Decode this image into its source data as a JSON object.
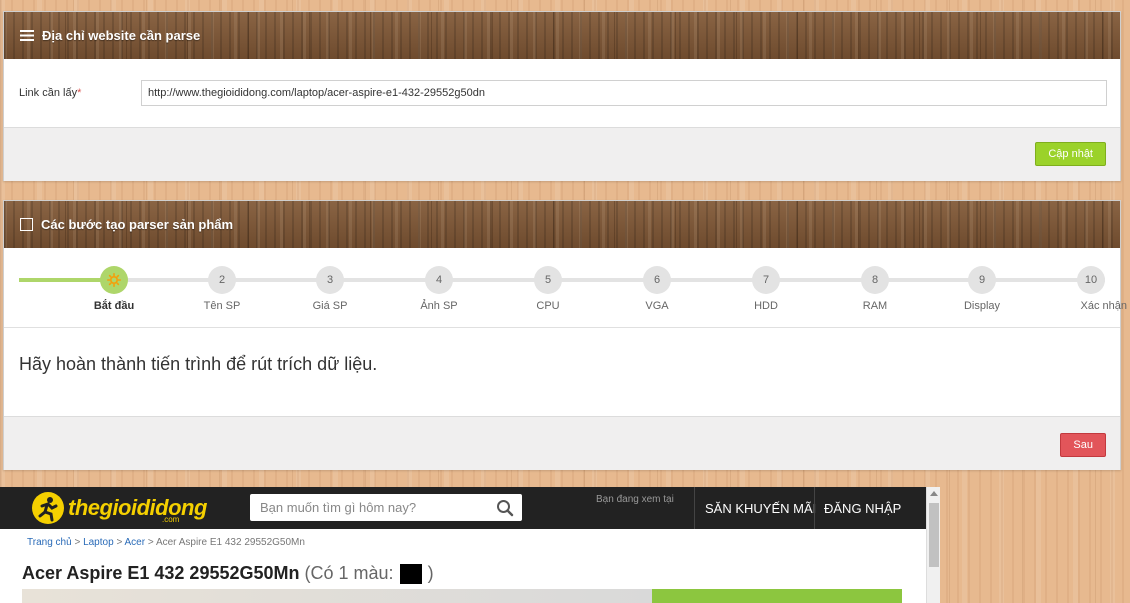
{
  "panel1": {
    "title": "Địa chỉ website cần parse",
    "title_icon": "menu-lines-icon",
    "link_label": "Link cần lấy",
    "required_mark": "*",
    "link_value": "http://www.thegioididong.com/laptop/acer-aspire-e1-432-29552g50dn",
    "update_button": "Cập nhật"
  },
  "panel2": {
    "title": "Các bước tạo parser sản phẩm",
    "title_icon": "checkbox-icon",
    "active_step": 1,
    "steps": [
      {
        "number": "",
        "label": "Bắt đầu",
        "icon": "gear-icon"
      },
      {
        "number": "2",
        "label": "Tên SP"
      },
      {
        "number": "3",
        "label": "Giá SP"
      },
      {
        "number": "4",
        "label": "Ảnh SP"
      },
      {
        "number": "5",
        "label": "CPU"
      },
      {
        "number": "6",
        "label": "VGA"
      },
      {
        "number": "7",
        "label": "HDD"
      },
      {
        "number": "8",
        "label": "RAM"
      },
      {
        "number": "9",
        "label": "Display"
      },
      {
        "number": "10",
        "label": "Xác nhận"
      }
    ],
    "message": "Hãy hoàn thành tiến trình để rút trích dữ liệu.",
    "next_button": "Sau"
  },
  "preview": {
    "logo_text": "thegioididong",
    "logo_sub": ".com",
    "search_placeholder": "Bạn muốn tìm gì hôm nay?",
    "viewing_label": "Bạn đang xem tại",
    "nav": [
      "SĂN KHUYẾN MÃI",
      "ĐĂNG NHẬP"
    ],
    "breadcrumb": [
      "Trang chủ",
      "Laptop",
      "Acer"
    ],
    "breadcrumb_sep": ">",
    "breadcrumb_current": "Acer Aspire E1 432 29552G50Mn",
    "product_title": "Acer Aspire E1 432 29552G50Mn",
    "colors_prefix": "(Có 1 màu:",
    "colors_suffix": ")"
  },
  "colors": {
    "accent_green": "#9bd22a",
    "step_done": "#aed66a",
    "button_red": "#e2555a",
    "brand_yellow": "#f5d000",
    "wood_header": "#7a5637"
  }
}
